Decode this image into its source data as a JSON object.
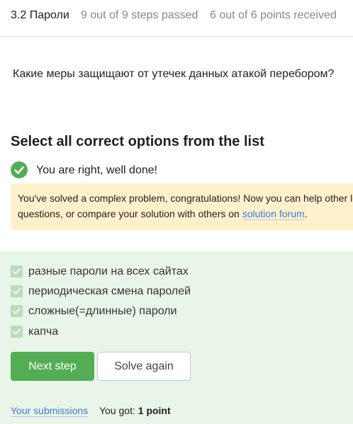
{
  "header": {
    "lesson": "3.2 Пароли",
    "steps_status": "9 out of 9 steps passed",
    "points_status": "6 out of 6 points  received"
  },
  "question": "Какие меры защищают от утечек данных атакой перебором?",
  "instruction": "Select all correct options from the list",
  "feedback": {
    "correct_message": "You are right, well done!",
    "hint_line1": "You've solved a complex problem, congratulations! Now you can help other le",
    "hint_line2_prefix": "questions, or compare your solution with others on ",
    "hint_link": "solution forum",
    "hint_line2_suffix": "."
  },
  "options": [
    {
      "label": "разные пароли на всех сайтах",
      "checked": true
    },
    {
      "label": "периодическая смена паролей",
      "checked": true
    },
    {
      "label": "сложные(=длинные) пароли",
      "checked": true
    },
    {
      "label": "капча",
      "checked": true
    }
  ],
  "buttons": {
    "next": "Next step",
    "solve_again": "Solve again"
  },
  "footer": {
    "submissions_link": "Your submissions",
    "got_label": "You got: ",
    "got_value": "1 point"
  },
  "colors": {
    "accent_green": "#54ad54",
    "panel_bg": "#e9f5e9",
    "hint_bg": "#fff0cc",
    "link_blue": "#3a7bd5"
  }
}
